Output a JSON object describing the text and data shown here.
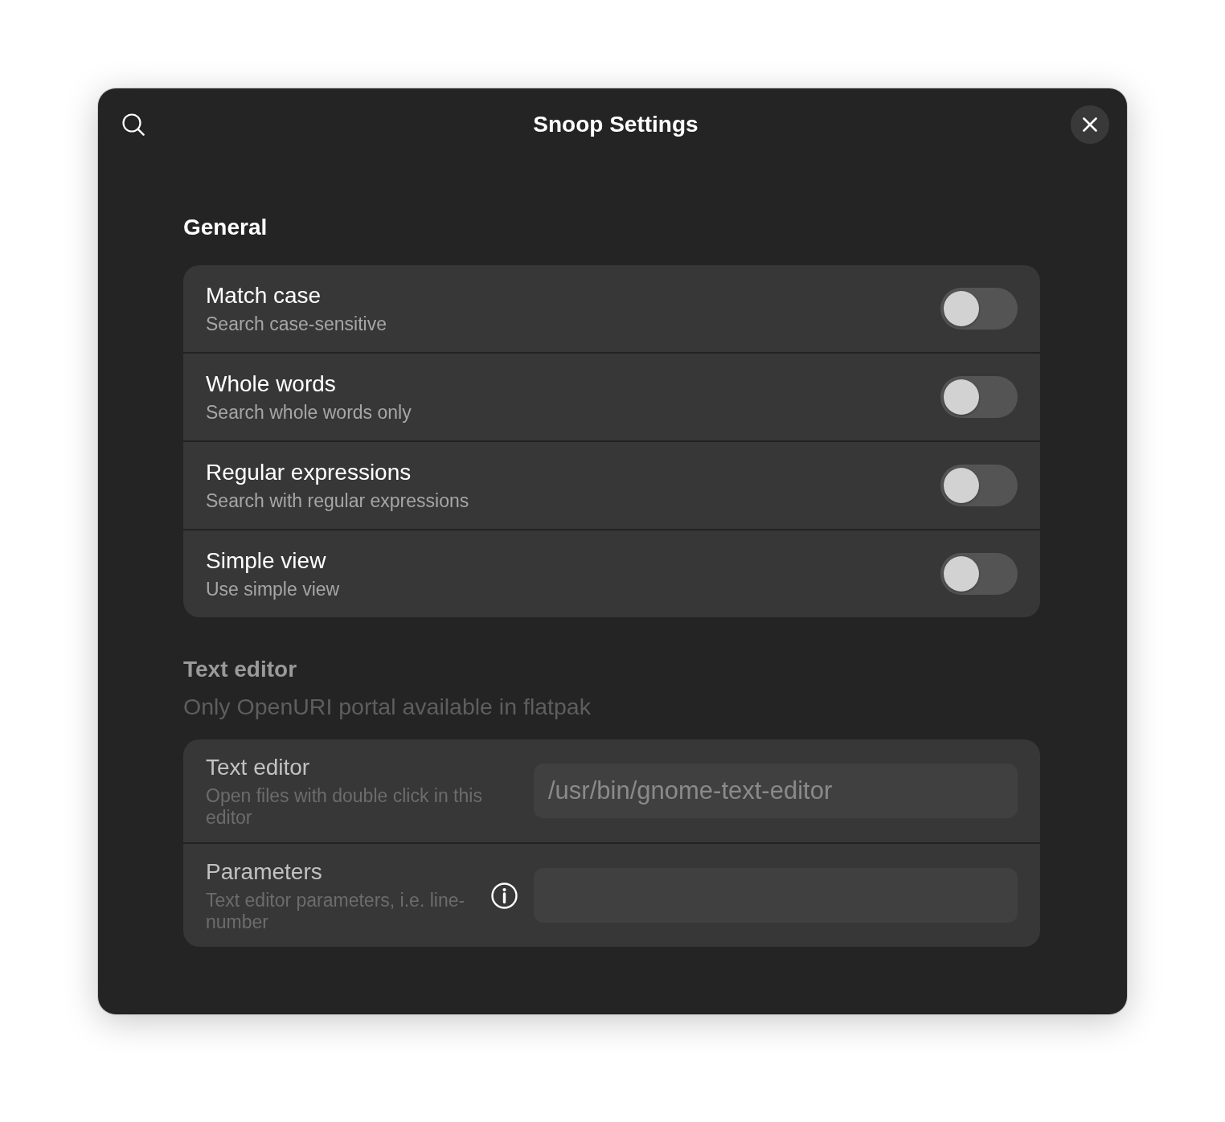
{
  "window": {
    "title": "Snoop Settings"
  },
  "sections": [
    {
      "kind": "toggles",
      "title": "General",
      "disabled": false,
      "rows": [
        {
          "title": "Match case",
          "subtitle": "Search case-sensitive",
          "on": false
        },
        {
          "title": "Whole words",
          "subtitle": "Search whole words only",
          "on": false
        },
        {
          "title": "Regular expressions",
          "subtitle": "Search with regular expressions",
          "on": false
        },
        {
          "title": "Simple view",
          "subtitle": "Use simple view",
          "on": false
        }
      ]
    },
    {
      "kind": "entries",
      "title": "Text editor",
      "description": "Only OpenURI portal available in flatpak",
      "disabled": true,
      "rows": [
        {
          "title": "Text editor",
          "subtitle": "Open files with double click in this editor",
          "value": "/usr/bin/gnome-text-editor"
        },
        {
          "title": "Parameters",
          "subtitle": "Text editor parameters, i.e. line-number",
          "info": true
        }
      ]
    }
  ]
}
